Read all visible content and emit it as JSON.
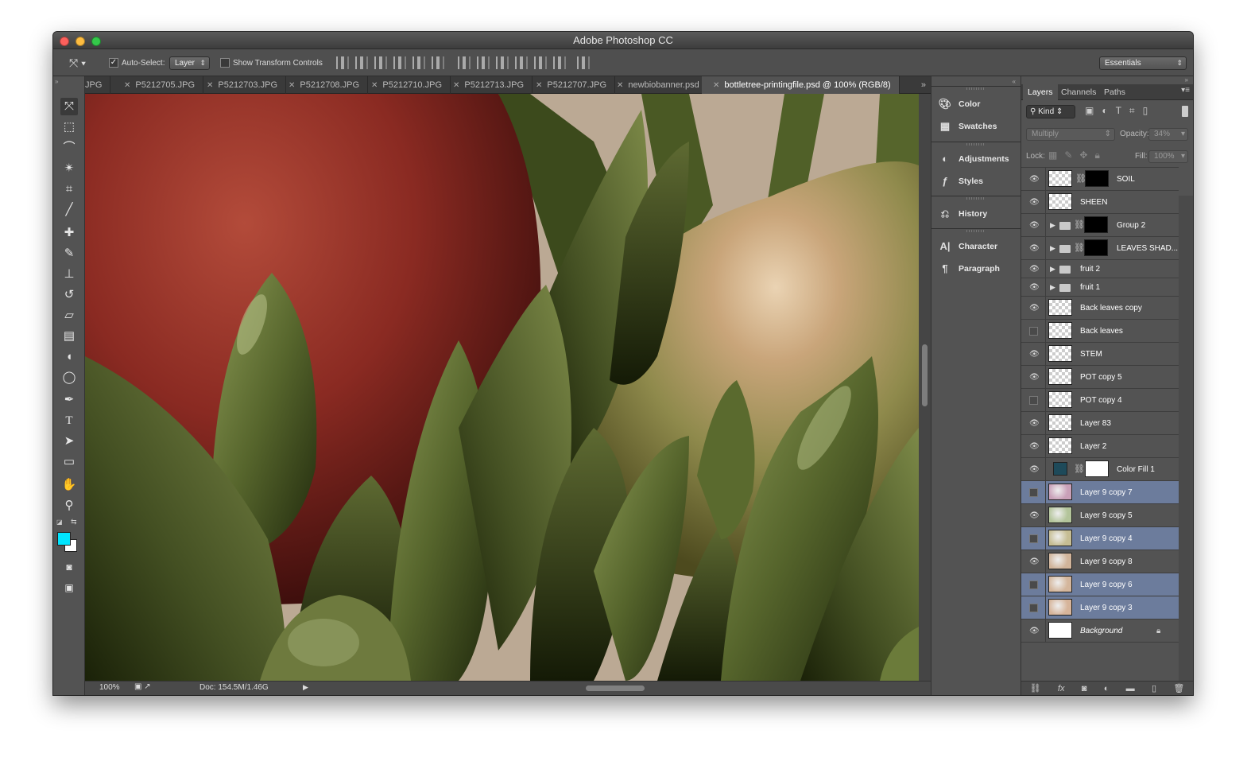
{
  "window": {
    "title": "Adobe Photoshop CC"
  },
  "options_bar": {
    "auto_select_label": "Auto-Select:",
    "auto_select_value": "Layer",
    "show_transform_label": "Show Transform Controls",
    "workspace": "Essentials"
  },
  "tabs": [
    {
      "label": "JPG",
      "active": false
    },
    {
      "label": "P5212705.JPG",
      "active": false
    },
    {
      "label": "P5212703.JPG",
      "active": false
    },
    {
      "label": "P5212708.JPG",
      "active": false
    },
    {
      "label": "P5212710.JPG",
      "active": false
    },
    {
      "label": "P5212713.JPG",
      "active": false
    },
    {
      "label": "P5212707.JPG",
      "active": false
    },
    {
      "label": "newbiobanner.psd",
      "active": false
    },
    {
      "label": "bottletree-printingfile.psd @ 100% (RGB/8)",
      "active": true
    }
  ],
  "status": {
    "zoom": "100%",
    "doc": "Doc: 154.5M/1.46G"
  },
  "collapsed_panels": [
    "Color",
    "Swatches",
    "Adjustments",
    "Styles",
    "History",
    "Character",
    "Paragraph"
  ],
  "layers_panel": {
    "tabs": [
      "Layers",
      "Channels",
      "Paths"
    ],
    "filter_label": "Kind",
    "blend_mode": "Multiply",
    "opacity_label": "Opacity:",
    "opacity_value": "34%",
    "lock_label": "Lock:",
    "fill_label": "Fill:",
    "fill_value": "100%",
    "layers": [
      {
        "name": "SOIL",
        "visible": true,
        "mask": true
      },
      {
        "name": "SHEEN",
        "visible": true
      },
      {
        "name": "Group 2",
        "visible": true,
        "group": true,
        "mask": true
      },
      {
        "name": "LEAVES SHAD...",
        "visible": true,
        "group": true,
        "mask": true
      },
      {
        "name": "fruit 2",
        "visible": true,
        "group": true
      },
      {
        "name": "fruit 1",
        "visible": true,
        "group": true
      },
      {
        "name": "Back leaves copy",
        "visible": true
      },
      {
        "name": "Back leaves",
        "visible": false
      },
      {
        "name": "STEM",
        "visible": true
      },
      {
        "name": "POT copy 5",
        "visible": true
      },
      {
        "name": "POT copy 4",
        "visible": false
      },
      {
        "name": "Layer 83",
        "visible": true
      },
      {
        "name": "Layer 2",
        "visible": true
      },
      {
        "name": "Color Fill 1",
        "visible": true,
        "fill": true
      },
      {
        "name": "Layer 9 copy 7",
        "visible": false,
        "selected": true,
        "swatch": "#c9a0b8"
      },
      {
        "name": "Layer 9 copy 5",
        "visible": true,
        "swatch": "#b3c49a"
      },
      {
        "name": "Layer 9 copy 4",
        "visible": false,
        "selected": true,
        "swatch": "#c6bd93"
      },
      {
        "name": "Layer 9 copy 8",
        "visible": true,
        "swatch": "#d1b49a"
      },
      {
        "name": "Layer 9 copy 6",
        "visible": false,
        "selected": true,
        "swatch": "#d4b69c"
      },
      {
        "name": "Layer 9 copy 3",
        "visible": false,
        "selected": true,
        "swatch": "#d6b49a"
      },
      {
        "name": "Background",
        "visible": true,
        "locked": true
      }
    ]
  },
  "colors": {
    "foreground": "#00e5ff",
    "background": "#ffffff",
    "selection": "#6c7c9c"
  }
}
